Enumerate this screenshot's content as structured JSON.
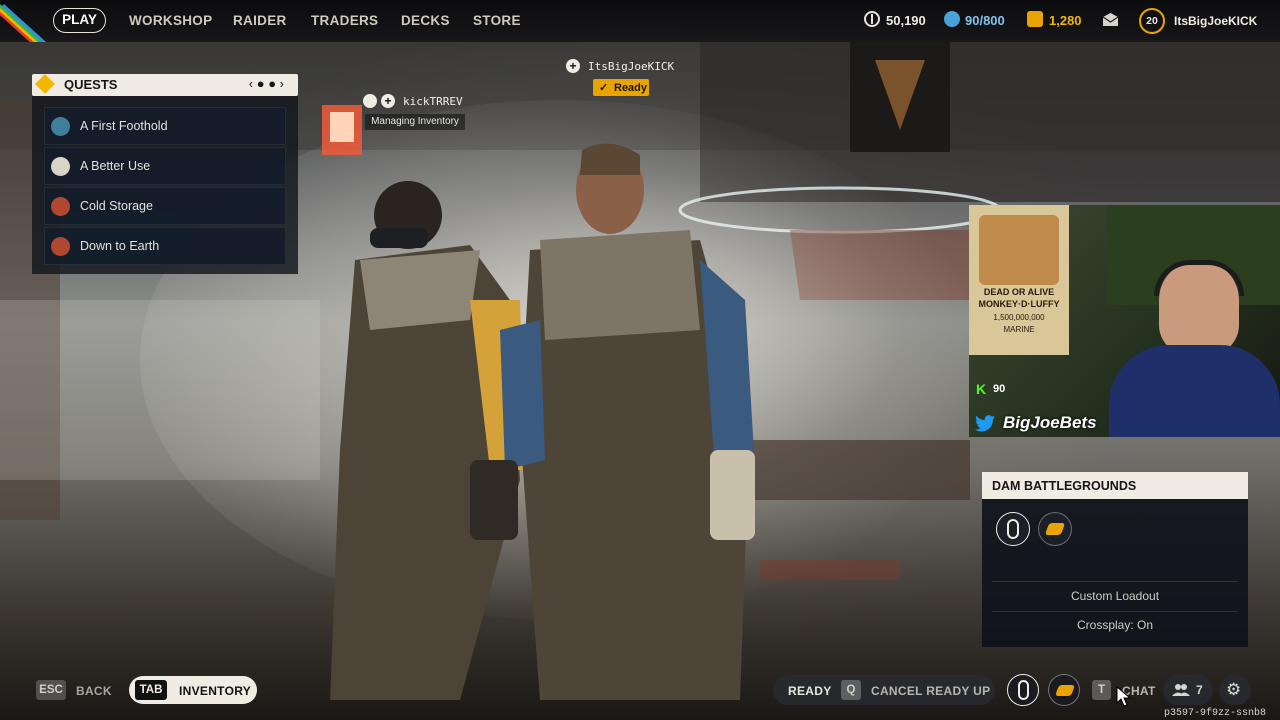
{
  "nav": {
    "play": "PLAY",
    "items": [
      "WORKSHOP",
      "RAIDER",
      "TRADERS",
      "DECKS",
      "STORE"
    ]
  },
  "stats": {
    "credits": "50,190",
    "capacity": "90/800",
    "raider_tokens": "1,280",
    "level": "20",
    "username": "ItsBigJoeKICK"
  },
  "quests": {
    "title": "QUESTS",
    "pager": "‹ ● ● ›",
    "items": [
      {
        "label": "A First Foothold",
        "avatar_color": "#3f7f9a"
      },
      {
        "label": "A Better Use",
        "avatar_color": "#d9d4c8"
      },
      {
        "label": "Cold Storage",
        "avatar_color": "#b0472f"
      },
      {
        "label": "Down to Earth",
        "avatar_color": "#b0472f"
      }
    ]
  },
  "players": {
    "self_name": "ItsBigJoeKICK",
    "self_status": "Ready",
    "teammate_name": "kickTRREV",
    "teammate_status": "Managing Inventory"
  },
  "webcam": {
    "kick_count": "90",
    "twitter_handle": "BigJoeBets",
    "poster_lines": [
      "DEAD OR ALIVE",
      "MONKEY·D·LUFFY",
      "1,500,000,000",
      "MARINE"
    ]
  },
  "match": {
    "map_title": "DAM BATTLEGROUNDS",
    "loadout": "Custom Loadout",
    "crossplay": "Crossplay: On"
  },
  "bottom": {
    "esc_key": "ESC",
    "back": "BACK",
    "tab_key": "TAB",
    "inventory": "INVENTORY",
    "ready": "READY",
    "q_key": "Q",
    "cancel": "CANCEL READY UP",
    "t_key": "T",
    "chat": "CHAT",
    "friends_count": "7",
    "session_id": "p3597-9f9zz-ssnb8"
  },
  "colors": {
    "accent_gold": "#f2b800",
    "panel_cream": "#f0ece4",
    "kick_green": "#53fc18",
    "twitter_blue": "#1d9bf0"
  }
}
